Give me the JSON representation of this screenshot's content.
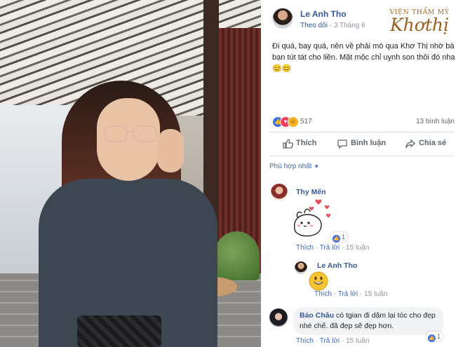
{
  "post": {
    "author": "Le Anh Tho",
    "follow_label": "Theo dõi",
    "separator": "·",
    "date": "3 Tháng 6",
    "text": "Đi quá, bay quá, nên về phải mò qua Khơ Thị nhờ bà bạn tút tát cho liền. Mặt mộc chỉ uỵnh son thôi đó nha 😊😊"
  },
  "watermark": {
    "top": "VIỆN THẨM MỸ",
    "brand": "Khơthị"
  },
  "stats": {
    "reaction_count": "517",
    "comment_count": "13 bình luận"
  },
  "actions": {
    "like": "Thích",
    "comment": "Bình luận",
    "share": "Chia sẻ"
  },
  "sort_label": "Phù hợp nhất",
  "comments": [
    {
      "author": "Thy Mến",
      "like_count": "1",
      "like_label": "Thích",
      "reply_label": "Trả lời",
      "age": "15 tuần"
    },
    {
      "author": "Le Anh Tho",
      "like_label": "Thích",
      "reply_label": "Trả lời",
      "age": "15 tuần"
    },
    {
      "author": "Bảo Châu",
      "text": "có tgian đi dặm lại tóc cho đẹp nhé chế. đã đẹp sẽ đẹp hơn.",
      "like_count": "1",
      "like_label": "Thích",
      "reply_label": "Trả lời",
      "age": "15 tuần"
    }
  ],
  "colors": {
    "link": "#365899",
    "like_blue": "#3b6ef0",
    "love_red": "#f2405d",
    "haha_yellow": "#f7b125",
    "muted": "#90949c"
  }
}
